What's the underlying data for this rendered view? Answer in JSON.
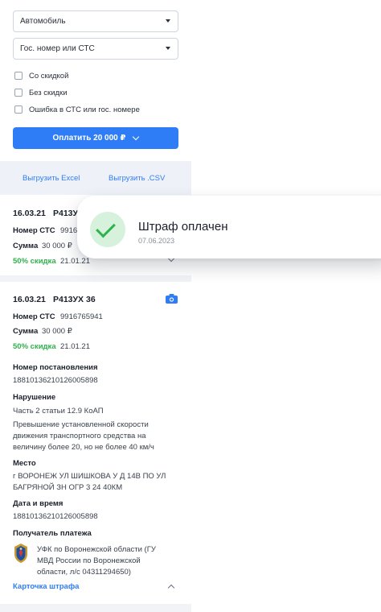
{
  "filters": {
    "vehicle_select": "Автомобиль",
    "number_select": "Гос. номер или СТС",
    "checkboxes": [
      "Со скидкой",
      "Без скидки",
      "Ошибка в СТС или гос. номере"
    ],
    "pay_button": "Оплатить 20 000 ₽"
  },
  "export": {
    "excel": "Выгрузить Excel",
    "csv": "Выгрузить .CSV"
  },
  "card1": {
    "date": "16.03.21",
    "plate": "Р413УХ",
    "sts_label": "Номер СТС",
    "sts_value": "9916",
    "sum_label": "Сумма",
    "sum_value": "30 000 ₽",
    "discount": "50% скидка",
    "discount_date": "21.01.21"
  },
  "card2": {
    "date": "16.03.21",
    "plate": "Р413УХ 36",
    "sts_label": "Номер СТС",
    "sts_value": "9916765941",
    "sum_label": "Сумма",
    "sum_value": "30 000 ₽",
    "discount": "50% скидка",
    "discount_date": "21.01.21",
    "resolution_label": "Номер постановления",
    "resolution_value": "18810136210126005898",
    "violation_label": "Нарушение",
    "violation_article": "Часть 2 статьи 12.9 КоАП",
    "violation_text_1": "Превышение установленной скорости",
    "violation_text_2": "движения транспортного средства на",
    "violation_text_3": "величину более 20, но не более 40 км/ч",
    "place_label": "Место",
    "place_text_1": "г ВОРОНЕЖ УЛ ШИШКОВА У Д 14В ПО УЛ",
    "place_text_2": "БАГРЯНОЙ ЗН ОГР 3 24 40КМ",
    "datetime_label": "Дата и время",
    "datetime_value": "18810136210126005898",
    "recipient_label": "Получатель платежа",
    "recipient_text_1": "УФК по Воронежской области (ГУ",
    "recipient_text_2": "МВД России по Воронежской",
    "recipient_text_3": "области, л/с 04311294650)",
    "card_link": "Карточка штрафа"
  },
  "toast": {
    "title": "Штраф оплачен",
    "date": "07.06.2023"
  },
  "colors": {
    "accent": "#2e7cf6",
    "success": "#2fb24c",
    "success_bg": "#d6f2dc"
  }
}
